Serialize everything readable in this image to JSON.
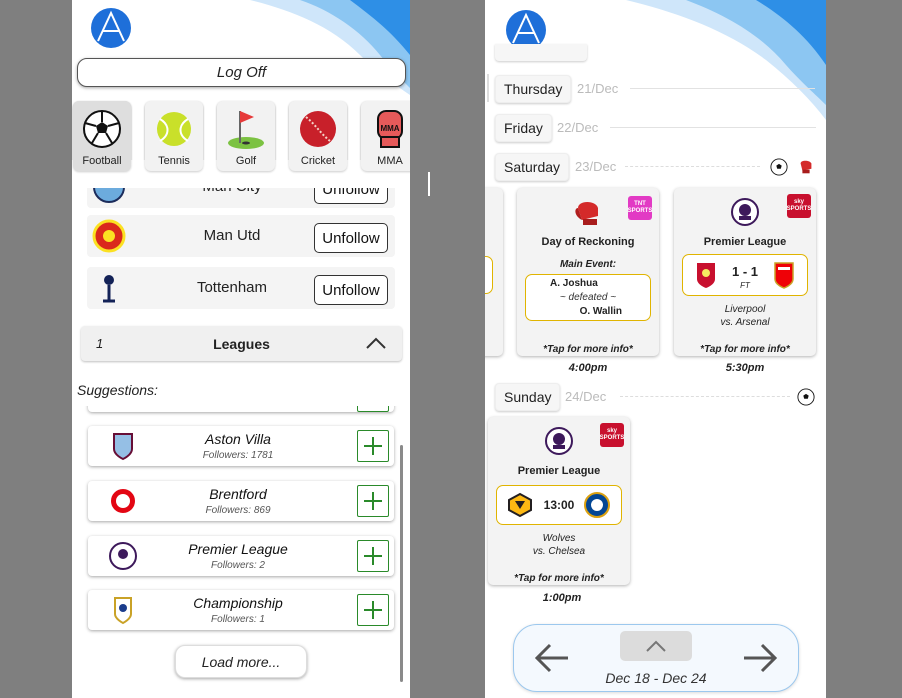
{
  "left": {
    "logoff_label": "Log Off",
    "sports": [
      {
        "label": "Football",
        "icon": "football-icon",
        "selected": true
      },
      {
        "label": "Tennis",
        "icon": "tennis-ball-icon"
      },
      {
        "label": "Golf",
        "icon": "golf-flag-icon"
      },
      {
        "label": "Cricket",
        "icon": "cricket-ball-icon"
      },
      {
        "label": "MMA",
        "icon": "boxing-glove-icon"
      }
    ],
    "followed": [
      {
        "name": "Man City",
        "button": "Unfollow"
      },
      {
        "name": "Man Utd",
        "button": "Unfollow"
      },
      {
        "name": "Tottenham",
        "button": "Unfollow"
      }
    ],
    "leagues_section": {
      "count": "1",
      "label": "Leagues"
    },
    "suggestions_heading": "Suggestions:",
    "suggestions": [
      {
        "name": "Aston Villa",
        "followers": "Followers: 1781"
      },
      {
        "name": "Brentford",
        "followers": "Followers: 869"
      },
      {
        "name": "Premier League",
        "followers": "Followers: 2"
      },
      {
        "name": "Championship",
        "followers": "Followers: 1"
      }
    ],
    "load_more": "Load more..."
  },
  "right": {
    "days": [
      {
        "day": "Thursday",
        "date": "21/Dec"
      },
      {
        "day": "Friday",
        "date": "22/Dec"
      },
      {
        "day": "Saturday",
        "date": "23/Dec"
      },
      {
        "day": "Sunday",
        "date": "24/Dec"
      }
    ],
    "sat_cards": [
      {
        "title": "Day of Reckoning",
        "broadcaster": "TNT SPORTS",
        "main_event_label": "Main Event:",
        "fighter1": "A. Joshua",
        "result": "~ defeated ~",
        "fighter2": "O. Wallin",
        "tap": "*Tap for more info*",
        "time": "4:00pm"
      },
      {
        "title": "Premier League",
        "broadcaster": "sky SPORTS",
        "score": "1 - 1",
        "status": "FT",
        "team1": "Liverpool",
        "team2": "vs. Arsenal",
        "tap": "*Tap for more info*",
        "time": "5:30pm"
      }
    ],
    "sun_card": {
      "title": "Premier League",
      "broadcaster": "sky SPORTS",
      "kickoff": "13:00",
      "team1": "Wolves",
      "team2": "vs. Chelsea",
      "tap": "*Tap for more info*",
      "time": "1:00pm"
    },
    "week_range": "Dec 18 - Dec 24"
  },
  "colors": {
    "accent_blue": "#1e6fd9",
    "wave_blue": "#a9d3f5",
    "gold_border": "#e0b400",
    "plus_green": "#2a8a2a"
  }
}
